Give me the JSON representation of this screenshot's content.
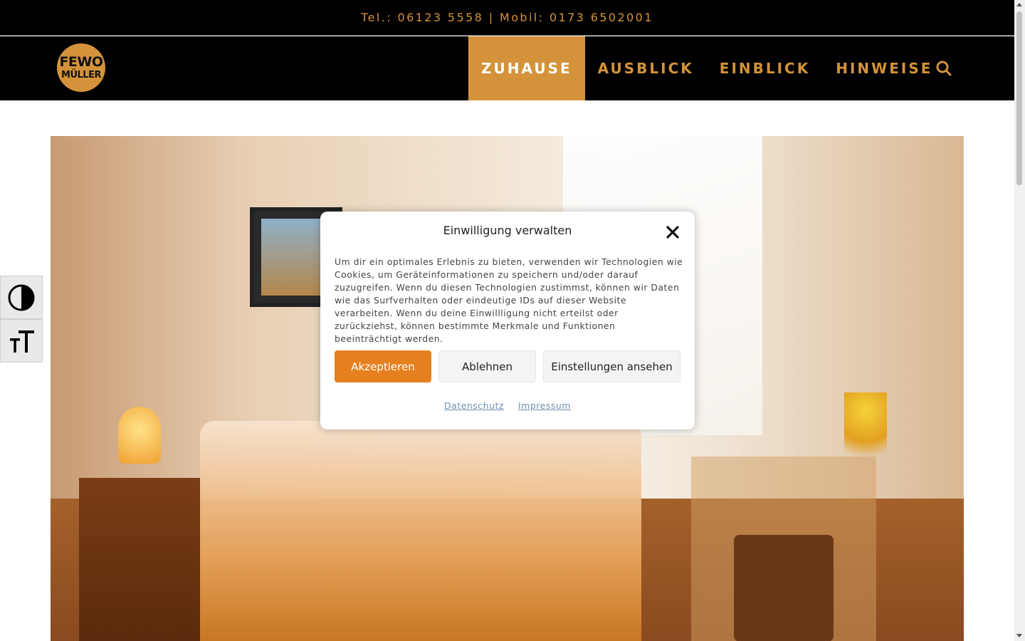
{
  "topbar": {
    "contact": "Tel.: 06123 5558 | Mobil: 0173 6502001"
  },
  "logo": {
    "line1": "FEWO",
    "line2": "MÜLLER"
  },
  "nav": {
    "items": [
      {
        "label": "ZUHAUSE",
        "active": true
      },
      {
        "label": "AUSBLICK",
        "active": false
      },
      {
        "label": "EINBLICK",
        "active": false
      },
      {
        "label": "HINWEISE",
        "active": false
      }
    ]
  },
  "icons": {
    "search": "search-icon",
    "contrast": "contrast-icon",
    "font_size": "font-size-icon",
    "close": "close-icon"
  },
  "colors": {
    "accent": "#d4933a",
    "accept_button": "#e6801f",
    "header_bg": "#000000"
  },
  "consent": {
    "title": "Einwilligung verwalten",
    "text": "Um dir ein optimales Erlebnis zu bieten, verwenden wir Technologien wie Cookies, um Geräteinformationen zu speichern und/oder darauf zuzugreifen. Wenn du diesen Technologien zustimmst, können wir Daten wie das Surfverhalten oder eindeutige IDs auf dieser Website verarbeiten. Wenn du deine Einwillligung nicht erteilst oder zurückziehst, können bestimmte Merkmale und Funktionen beeinträchtigt werden.",
    "accept_label": "Akzeptieren",
    "deny_label": "Ablehnen",
    "settings_label": "Einstellungen ansehen",
    "privacy_link": "Datenschutz",
    "imprint_link": "Impressum"
  }
}
